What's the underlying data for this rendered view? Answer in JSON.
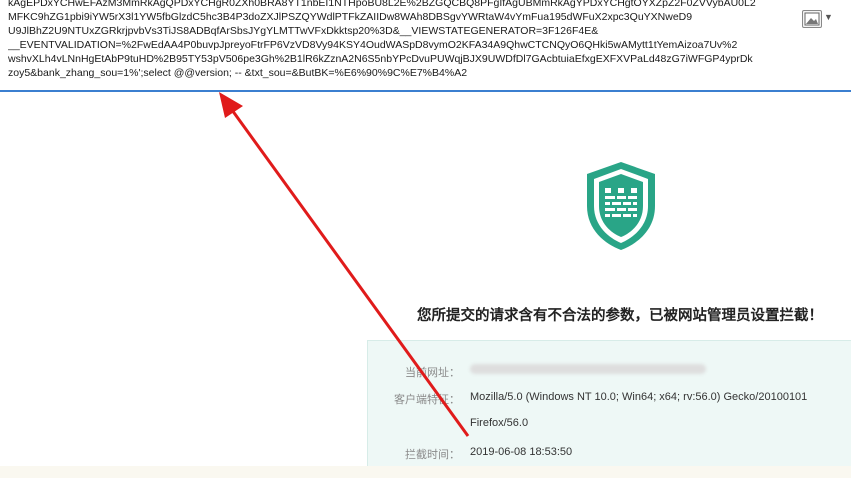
{
  "request_body": {
    "lines": [
      "kAgEPDxYCHwEFAzM3MmRkAgQPDxYCHgR0ZXh0BRA8YT1nbEI1NTHpoBU8L2E%2BZGQCBQ8PFgIfAgUBMmRkAgYPDxYCHgtOYXZpZ2F0ZVVybAU0L2",
      "MFKC9hZG1pbi9iYW5rX3l1YW5fbGlzdC5hc3B4P3doZXJlPSZQYWdlPTFkZAIIDw8WAh8DBSgvYWRtaW4vYmFua195dWFuX2xpc3QuYXNweD9",
      "U9JlBhZ2U9NTUxZGRkrjpvbVs3TiJS8ADBqfArSbsJYgYLMTTwVFxDkktsp20%3D&__VIEWSTATEGENERATOR=3F126F4E&",
      "__EVENTVALIDATION=%2FwEdAA4P0buvpJpreyoFtrFP6VzVD8Vy94KSY4OudWASpD8vymO2KFA34A9QhwCTCNQyO6QHki5wAMytt1tYemAizoa7Uv%2",
      "wshvXLh4vLNnHgEtAbP9tuHD%2B95TY53pV506pe3Gh%2B1lR6kZznA2N6S5nbYPcDvuPUWqjBJX9UWDfDl7GAcbtuiaEfxgEXFXVPaLd48zG7iWFGP4yprDk",
      "zoy5&bank_zhang_sou=1%';select @@version; -- &txt_sou=&ButBK=%E6%90%9C%E7%B4%A2"
    ]
  },
  "block_page": {
    "title": "您所提交的请求含有不合法的参数，已被网站管理员设置拦截！",
    "url_label": "当前网址：",
    "agent_label": "客户端特征：",
    "agent_value_line1": "Mozilla/5.0 (Windows NT 10.0; Win64; x64; rv:56.0) Gecko/20100101",
    "agent_value_line2": "Firefox/56.0",
    "time_label": "拦截时间：",
    "time_value": "2019-06-08 18:53:50"
  },
  "colors": {
    "shield_green": "#29a587",
    "arrow_red": "#e01b1b",
    "highlight_border": "#3b7fd0"
  },
  "icons": {
    "shield": "firewall-shield-icon",
    "image_button": "image-icon",
    "dropdown": "chevron-down-icon"
  }
}
